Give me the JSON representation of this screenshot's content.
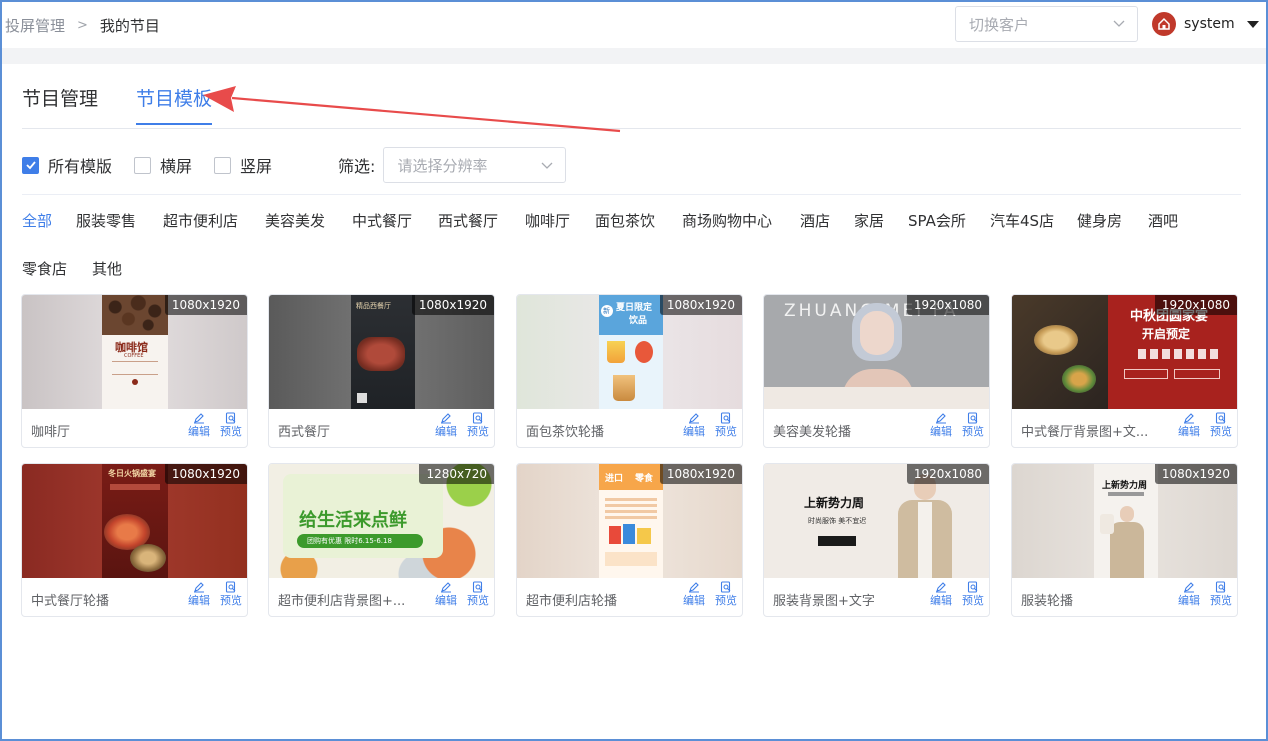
{
  "breadcrumb": {
    "first": "投屏管理",
    "separator": ">",
    "second": "我的节目"
  },
  "client_select": {
    "placeholder": "切换客户"
  },
  "user": {
    "name": "system"
  },
  "tabs": [
    {
      "label": "节目管理"
    },
    {
      "label": "节目模板"
    }
  ],
  "filters": {
    "checkboxes": [
      {
        "label": "所有模版",
        "checked": true
      },
      {
        "label": "横屏",
        "checked": false
      },
      {
        "label": "竖屏",
        "checked": false
      }
    ],
    "label": "筛选:",
    "resolution_placeholder": "请选择分辨率"
  },
  "categories": [
    "全部",
    "服装零售",
    "超市便利店",
    "美容美发",
    "中式餐厅",
    "西式餐厅",
    "咖啡厅",
    "面包茶饮",
    "商场购物中心",
    "酒店",
    "家居",
    "SPA会所",
    "汽车4S店",
    "健身房",
    "酒吧",
    "零食店",
    "其他"
  ],
  "actions": {
    "edit": "编辑",
    "preview": "预览"
  },
  "cards": [
    {
      "name": "咖啡厅",
      "resolution": "1080x1920",
      "poster": [
        "咖啡馆",
        "COFFEE"
      ]
    },
    {
      "name": "西式餐厅",
      "resolution": "1080x1920",
      "poster": [
        "精品西餐厅"
      ]
    },
    {
      "name": "面包茶饮轮播",
      "resolution": "1080x1920",
      "poster": [
        "夏日限定",
        "饮品",
        "新"
      ]
    },
    {
      "name": "美容美发轮播",
      "resolution": "1920x1080",
      "poster": [
        "ZHUANG MEI FA"
      ]
    },
    {
      "name": "中式餐厅背景图+文...",
      "resolution": "1920x1080",
      "poster": [
        "中秋团圆家宴",
        "开启预定"
      ]
    },
    {
      "name": "中式餐厅轮播",
      "resolution": "1080x1920",
      "poster": [
        "冬日火锅盛宴"
      ]
    },
    {
      "name": "超市便利店背景图+...",
      "resolution": "1280x720",
      "poster": [
        "给生活来点鲜",
        "团购有优惠 限时6.15-6.18"
      ]
    },
    {
      "name": "超市便利店轮播",
      "resolution": "1080x1920",
      "poster": [
        "进口",
        "零食"
      ]
    },
    {
      "name": "服装背景图+文字",
      "resolution": "1920x1080",
      "poster": [
        "上新势力周",
        "时尚服饰 美不宜迟"
      ]
    },
    {
      "name": "服装轮播",
      "resolution": "1080x1920",
      "poster": [
        "上新势力周"
      ]
    }
  ],
  "colors": {
    "accent": "#3f7ee8",
    "annotation_arrow": "#e84b4b"
  }
}
